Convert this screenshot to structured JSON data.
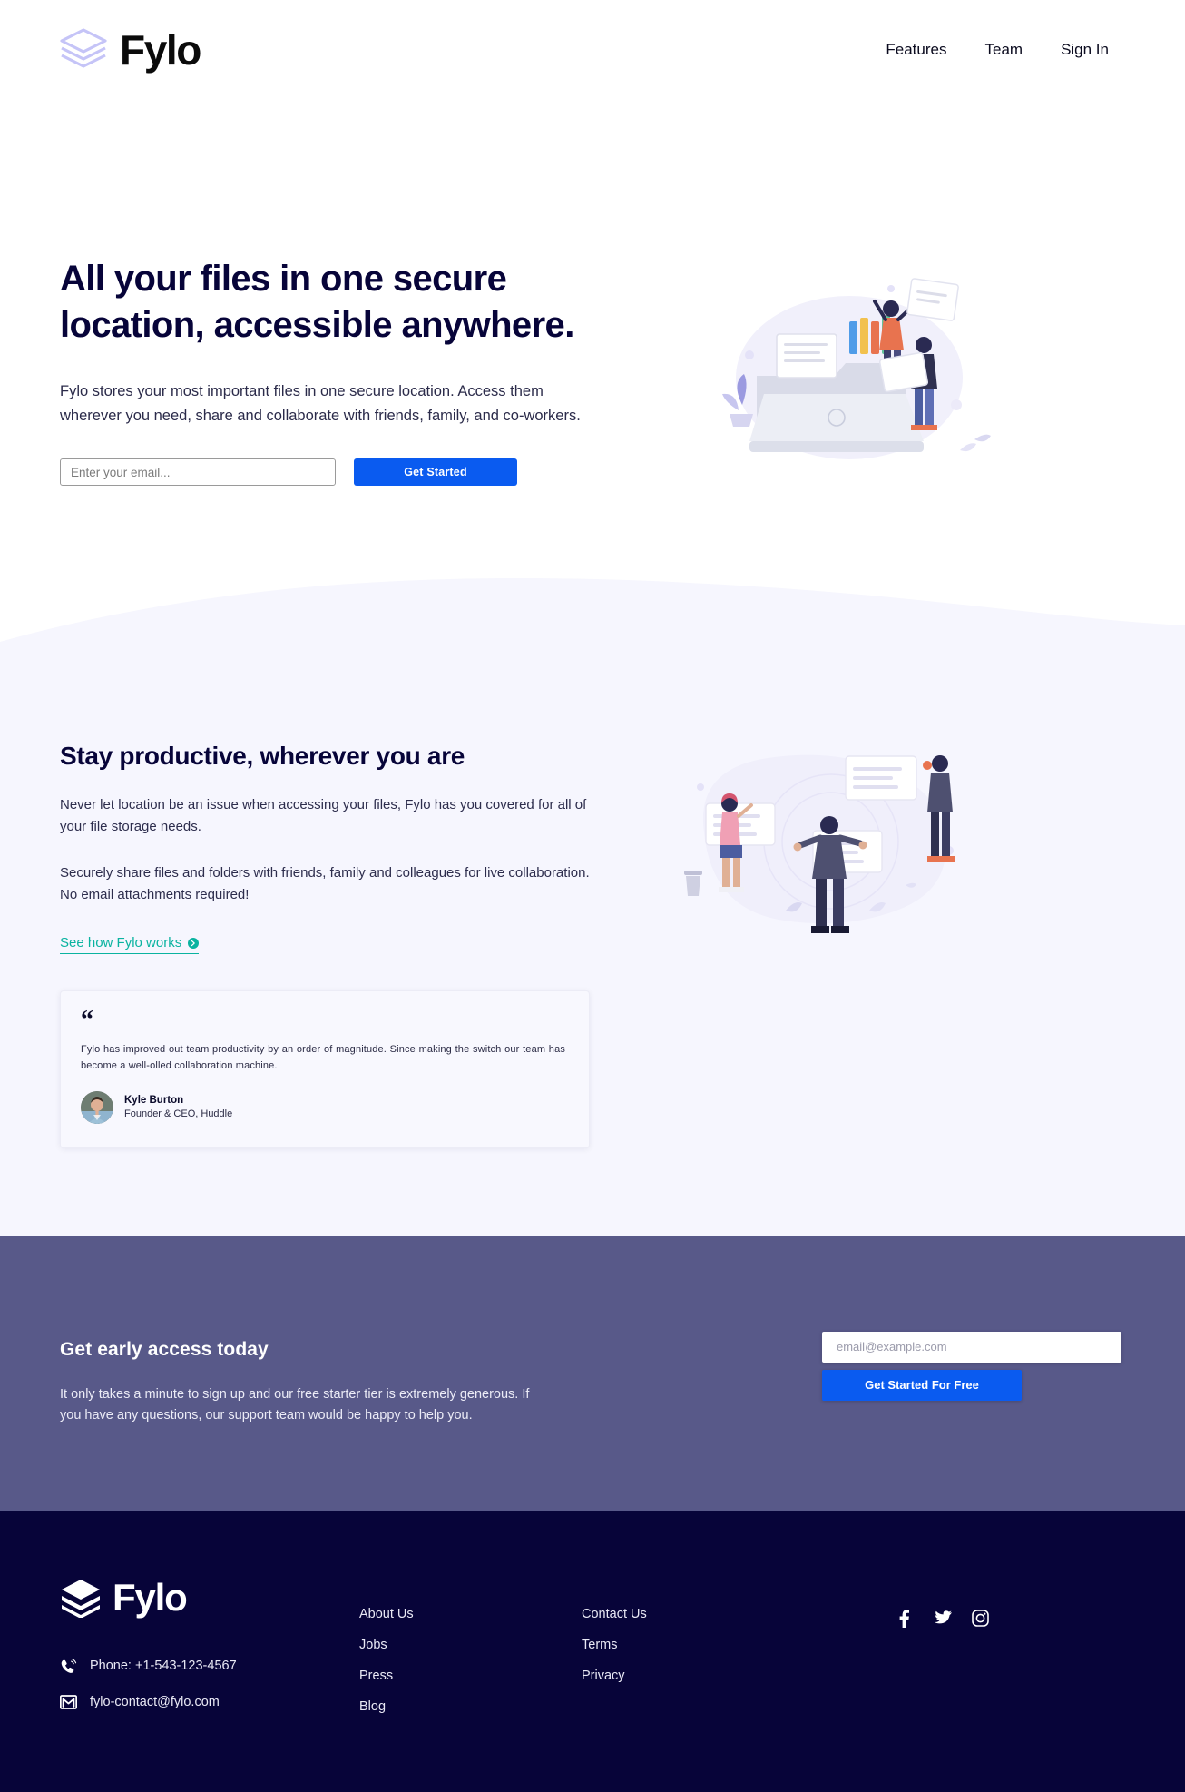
{
  "brand": {
    "name": "Fylo",
    "logo_icon": "layers-stack-icon"
  },
  "nav": {
    "items": [
      {
        "label": "Features"
      },
      {
        "label": "Team"
      },
      {
        "label": "Sign In"
      }
    ]
  },
  "hero": {
    "heading_line1": "All your files in one secure",
    "heading_line2": "location, accessible anywhere.",
    "body": "Fylo stores your most important files in one secure location. Access them wherever you need, share and collaborate with friends, family, and co-workers.",
    "email_placeholder": "Enter your email...",
    "email_value": "",
    "cta_label": "Get Started",
    "illustration": "people-organizing-files-illustration"
  },
  "productive": {
    "heading": "Stay productive, wherever you are",
    "paragraph1": "Never let location be an issue when accessing your files, Fylo has you covered for all of your file storage needs.",
    "paragraph2": "Securely share files and folders with friends, family and colleagues for live collaboration. No email attachments required!",
    "link_label": "See how Fylo works",
    "link_icon": "arrow-right-circle-icon",
    "illustration": "team-collaboration-illustration",
    "testimonial": {
      "quote_icon": "quote-mark-icon",
      "quote": "Fylo has improved out team productivity by an order of magnitude. Since making the switch our team has become a well-olled collaboration machine.",
      "author_name": "Kyle Burton",
      "author_role": "Founder & CEO, Huddle",
      "avatar": "kyle-burton-avatar"
    }
  },
  "cta": {
    "heading": "Get early access today",
    "body": "It only takes a minute to sign up and our free starter tier is extremely generous. If you have any questions, our support team would be happy to help you.",
    "email_placeholder": "email@example.com",
    "email_value": "",
    "button_label": "Get Started For Free"
  },
  "footer": {
    "phone_icon": "phone-icon",
    "phone": "Phone: +1-543-123-4567",
    "email_icon": "mail-icon",
    "email": "fylo-contact@fylo.com",
    "links_col1": [
      {
        "label": "About Us"
      },
      {
        "label": "Jobs"
      },
      {
        "label": "Press"
      },
      {
        "label": "Blog"
      }
    ],
    "links_col2": [
      {
        "label": "Contact Us"
      },
      {
        "label": "Terms"
      },
      {
        "label": "Privacy"
      }
    ],
    "social": [
      {
        "name": "facebook-icon"
      },
      {
        "name": "twitter-icon"
      },
      {
        "name": "instagram-icon"
      }
    ]
  },
  "colors": {
    "accent_blue": "#0a5bf0",
    "teal": "#0ab3a0",
    "dark_navy": "#070439",
    "cta_purple": "#585989",
    "light_lavender": "#f6f6fe",
    "logo_purple": "#c5c4f7"
  }
}
